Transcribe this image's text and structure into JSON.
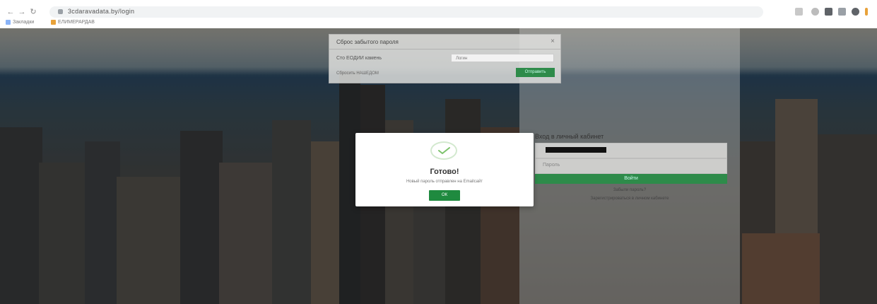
{
  "browser": {
    "url": "3cdaravadata.by/login",
    "bookmarks": [
      {
        "label": "Закладки",
        "color": "#8ab4f8"
      },
      {
        "label": "ЕЛИМЕРАРДАВ",
        "color": "#e8a23a"
      }
    ]
  },
  "password_modal": {
    "title": "Сброс забытого пароля",
    "label": "Сто ЕОДИИ камень",
    "input_value": "Логин",
    "link": "Сбросить НАШЕДОМ",
    "submit_label": "Отправить",
    "close_label": "×"
  },
  "login_panel": {
    "title": "Вход в личный кабинет",
    "password_placeholder": "Пароль",
    "login_button": "Войти",
    "links": [
      "Забыли пароль?",
      "Зарегистрироваться в личном кабинете"
    ]
  },
  "success_dialog": {
    "title": "Готово!",
    "message": "Новый пароль отправлен на Emailсайт",
    "ok_label": "ОК"
  },
  "colors": {
    "accent_green": "#1f8a3f",
    "check_green": "#7cc26b"
  }
}
